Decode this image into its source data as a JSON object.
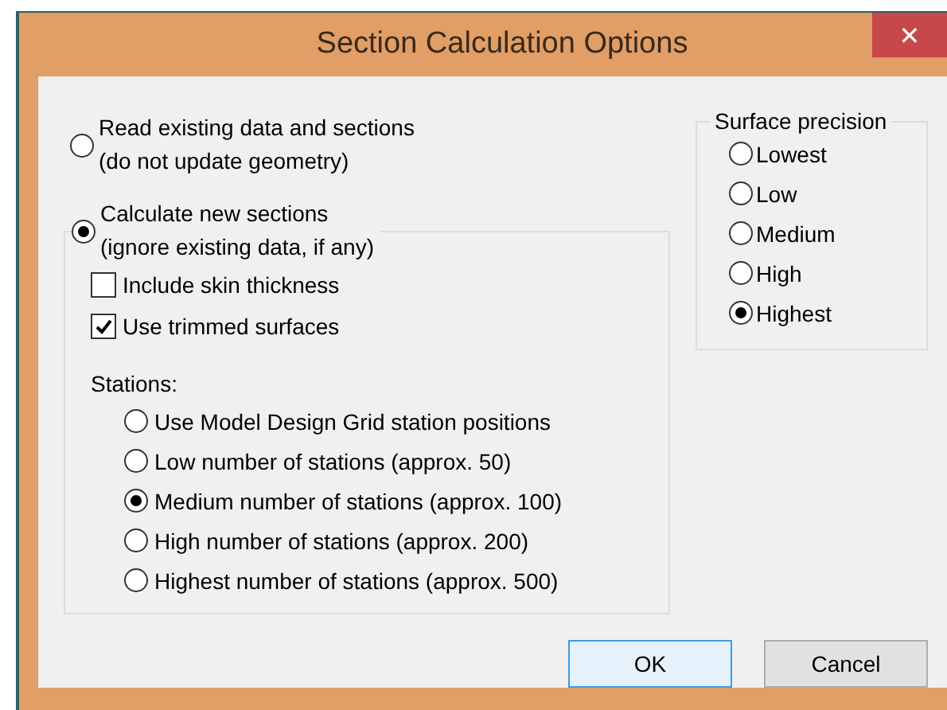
{
  "window": {
    "title": "Section Calculation Options",
    "close": "✕"
  },
  "modes": [
    {
      "lines": [
        "Read existing data and sections",
        "(do not update geometry)"
      ],
      "selected": false
    },
    {
      "lines": [
        "Calculate new sections",
        "(ignore existing data, if any)"
      ],
      "selected": true
    }
  ],
  "checkboxes": [
    {
      "label": "Include skin thickness",
      "checked": false
    },
    {
      "label": "Use trimmed surfaces",
      "checked": true
    }
  ],
  "stations": {
    "label": "Stations:",
    "options": [
      {
        "label": "Use Model Design Grid station positions",
        "selected": false
      },
      {
        "label": "Low number of stations (approx. 50)",
        "selected": false
      },
      {
        "label": "Medium number of stations (approx. 100)",
        "selected": true
      },
      {
        "label": "High number of stations (approx. 200)",
        "selected": false
      },
      {
        "label": "Highest number of stations (approx. 500)",
        "selected": false
      }
    ]
  },
  "surface_precision": {
    "title": "Surface precision",
    "options": [
      {
        "label": "Lowest",
        "selected": false
      },
      {
        "label": "Low",
        "selected": false
      },
      {
        "label": "Medium",
        "selected": false
      },
      {
        "label": "High",
        "selected": false
      },
      {
        "label": "Highest",
        "selected": true
      }
    ]
  },
  "buttons": [
    {
      "label": "OK",
      "default": true
    },
    {
      "label": "Cancel",
      "default": false
    }
  ]
}
